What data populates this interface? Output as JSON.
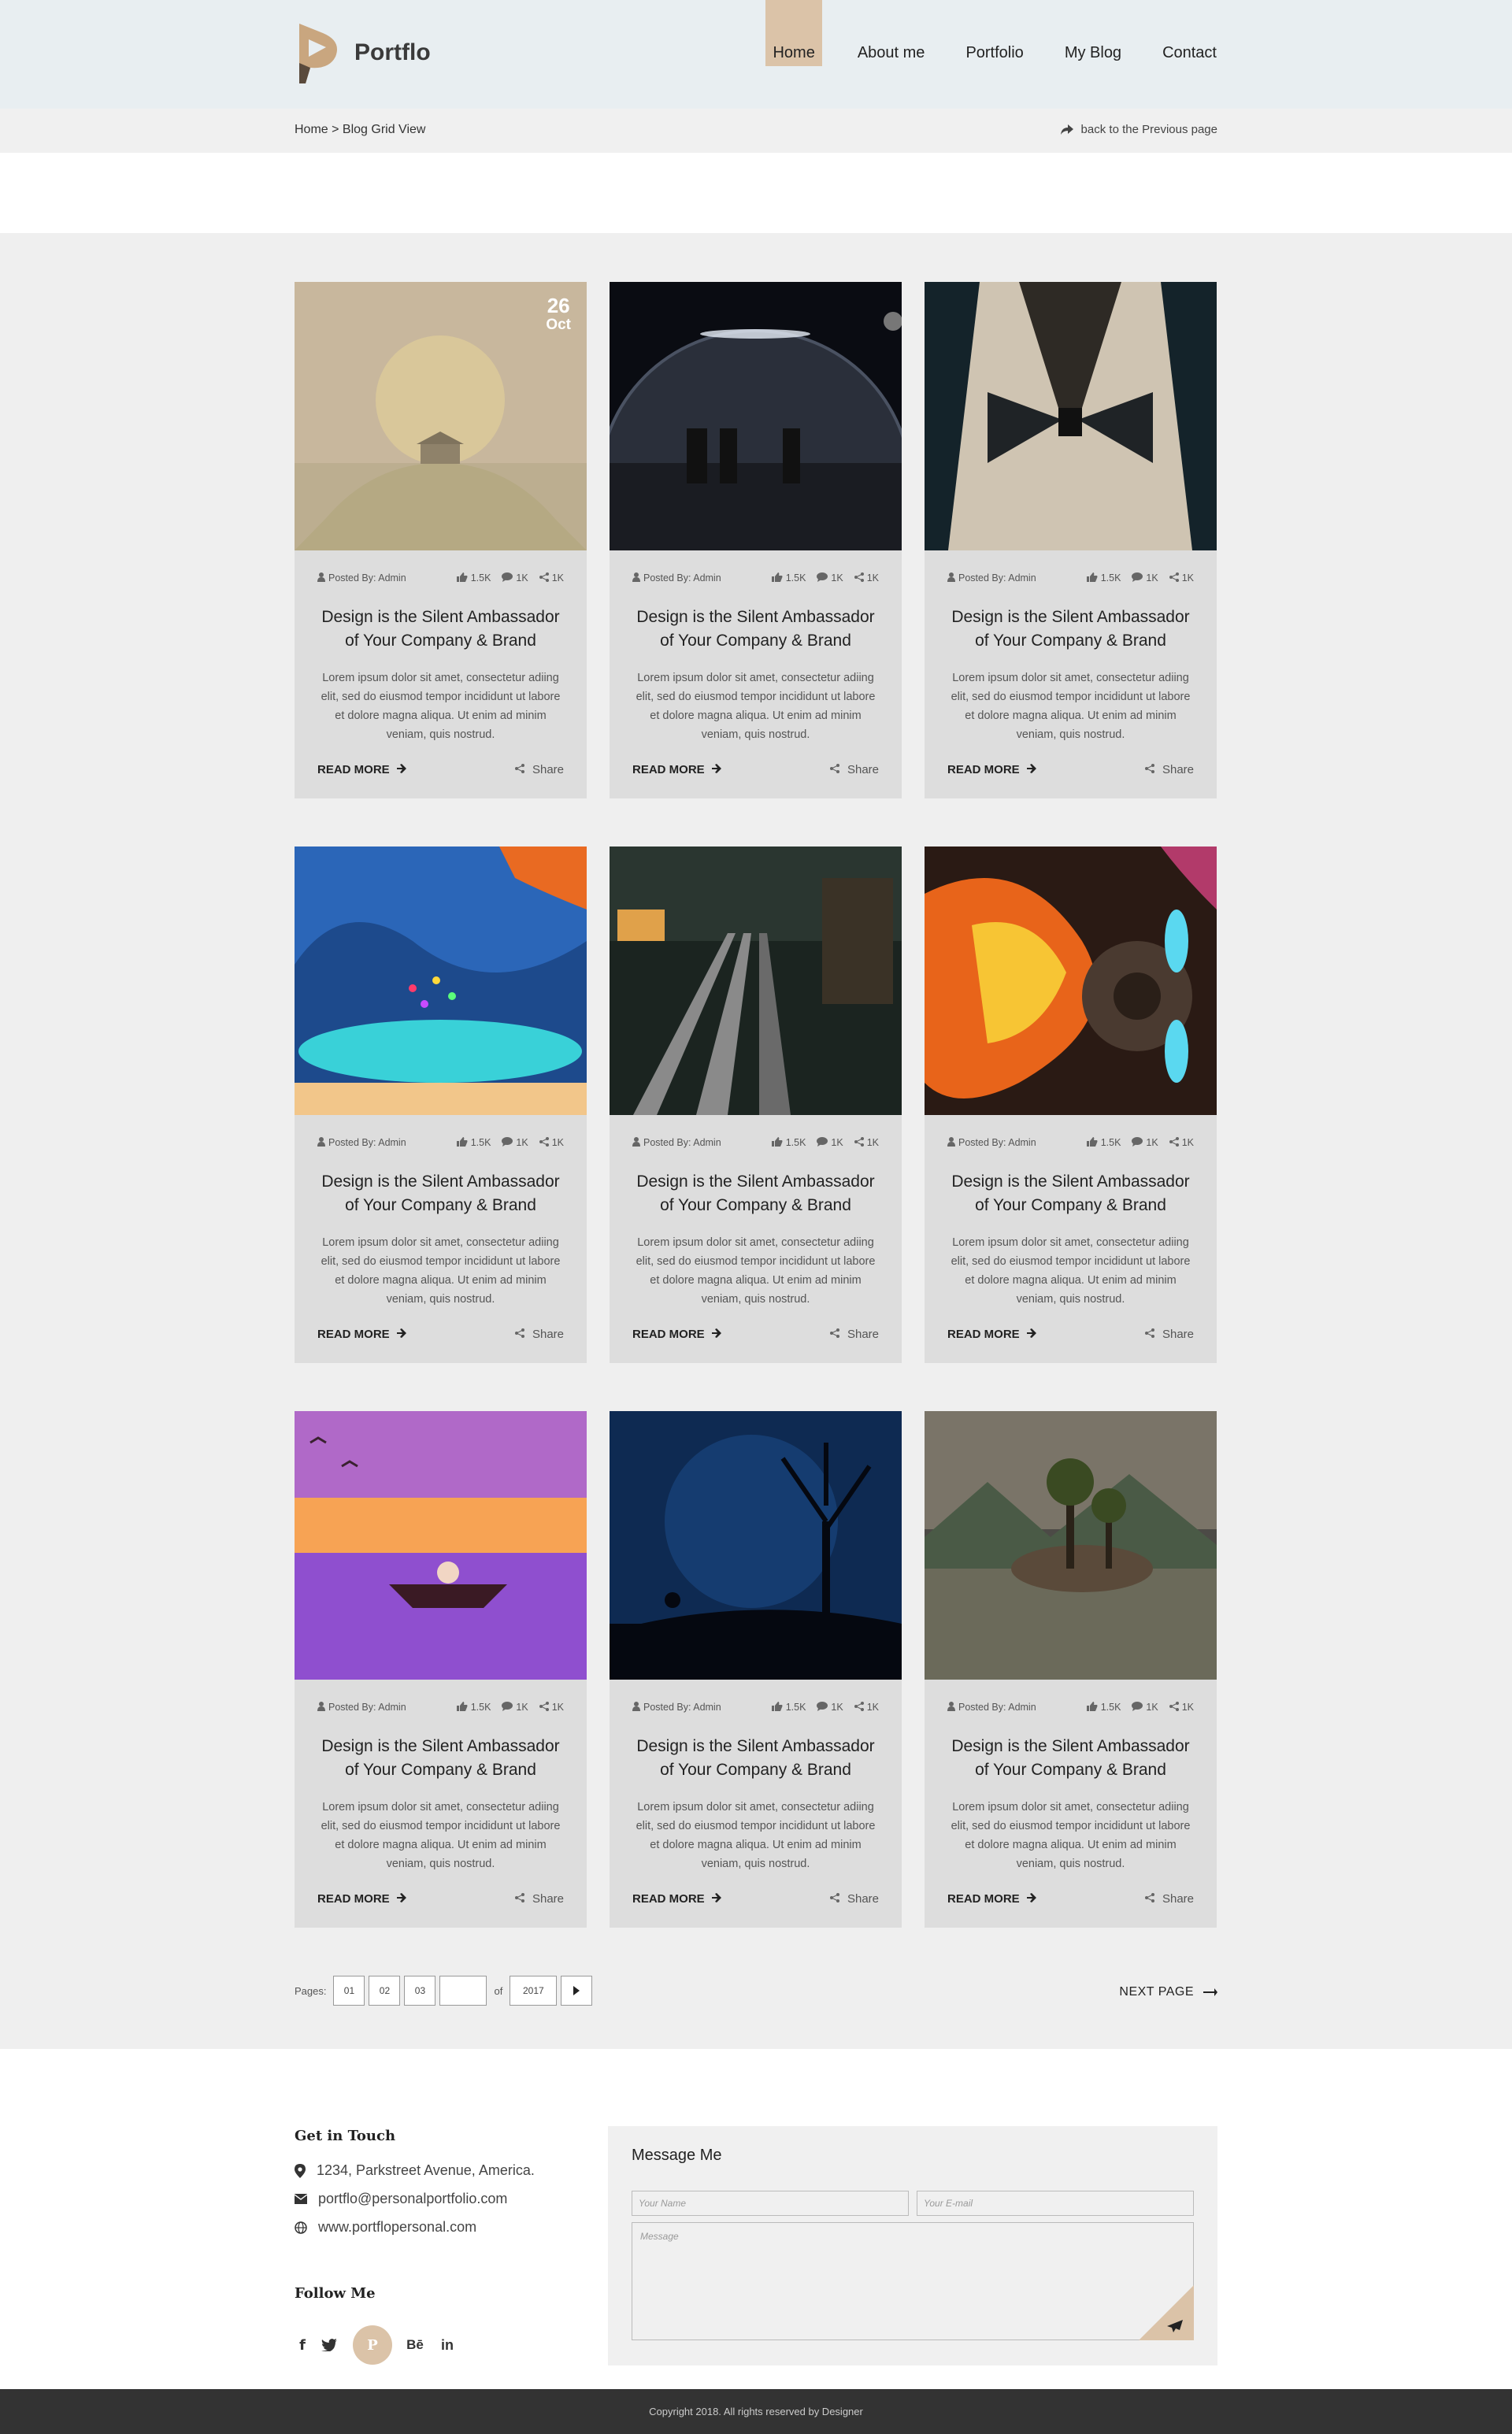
{
  "brand": {
    "name": "Portflo",
    "accent": "#dbc3a8"
  },
  "nav": {
    "items": [
      "Home",
      "About me",
      "Portfolio",
      "My Blog",
      "Contact"
    ],
    "active": "Home"
  },
  "breadcrumb": {
    "text": "Home > Blog Grid View",
    "back_label": "back to the Previous page"
  },
  "featured_date": {
    "day": "26",
    "month": "Oct"
  },
  "post_meta": {
    "posted_by": "Posted By: Admin",
    "likes": "1.5K",
    "comments": "1K",
    "shares": "1K"
  },
  "posts": [
    {
      "title_line1": "Design is the Silent Ambassador",
      "title_line2": "of Your Company & Brand",
      "excerpt": "Lorem ipsum dolor sit amet, consectetur adiing elit, sed do eiusmod tempor incididunt ut labore et dolore magna aliqua. Ut enim ad minim veniam, quis nostrud."
    },
    {
      "title_line1": "Design is the Silent Ambassador",
      "title_line2": "of Your Company & Brand",
      "excerpt": "Lorem ipsum dolor sit amet, consectetur adiing elit, sed do eiusmod tempor incididunt ut labore et dolore magna aliqua. Ut enim ad minim veniam, quis nostrud."
    },
    {
      "title_line1": "Design is the Silent Ambassador",
      "title_line2": "of Your Company & Brand",
      "excerpt": "Lorem ipsum dolor sit amet, consectetur adiing elit, sed do eiusmod tempor incididunt ut labore et dolore magna aliqua. Ut enim ad minim veniam, quis nostrud."
    },
    {
      "title_line1": "Design is the Silent Ambassador",
      "title_line2": "of Your Company & Brand",
      "excerpt": "Lorem ipsum dolor sit amet, consectetur adiing elit, sed do eiusmod tempor incididunt ut labore et dolore magna aliqua. Ut enim ad minim veniam, quis nostrud."
    },
    {
      "title_line1": "Design is the Silent Ambassador",
      "title_line2": "of Your Company & Brand",
      "excerpt": "Lorem ipsum dolor sit amet, consectetur adiing elit, sed do eiusmod tempor incididunt ut labore et dolore magna aliqua. Ut enim ad minim veniam, quis nostrud."
    },
    {
      "title_line1": "Design is the Silent Ambassador",
      "title_line2": "of Your Company & Brand",
      "excerpt": "Lorem ipsum dolor sit amet, consectetur adiing elit, sed do eiusmod tempor incididunt ut labore et dolore magna aliqua. Ut enim ad minim veniam, quis nostrud."
    },
    {
      "title_line1": "Design is the Silent Ambassador",
      "title_line2": "of Your Company & Brand",
      "excerpt": "Lorem ipsum dolor sit amet, consectetur adiing elit, sed do eiusmod tempor incididunt ut labore et dolore magna aliqua. Ut enim ad minim veniam, quis nostrud."
    },
    {
      "title_line1": "Design is the Silent Ambassador",
      "title_line2": "of Your Company & Brand",
      "excerpt": "Lorem ipsum dolor sit amet, consectetur adiing elit, sed do eiusmod tempor incididunt ut labore et dolore magna aliqua. Ut enim ad minim veniam, quis nostrud."
    },
    {
      "title_line1": "Design is the Silent Ambassador",
      "title_line2": "of Your Company & Brand",
      "excerpt": "Lorem ipsum dolor sit amet, consectetur adiing elit, sed do eiusmod tempor incididunt ut labore et dolore magna aliqua. Ut enim ad minim veniam, quis nostrud."
    }
  ],
  "card_actions": {
    "read_more": "READ MORE",
    "share": "Share"
  },
  "pagination": {
    "label": "Pages:",
    "pages": [
      "01",
      "02",
      "03"
    ],
    "current": "",
    "of": "of",
    "total": "2017",
    "next_label": "NEXT PAGE"
  },
  "contact": {
    "title": "Get in Touch",
    "address": "1234, Parkstreet Avenue, America.",
    "email": "portflo@personalportfolio.com",
    "website": "www.portflopersonal.com",
    "follow_title": "Follow Me",
    "socials": [
      "f",
      "twitter",
      "P",
      "Bē",
      "in"
    ]
  },
  "message_form": {
    "title": "Message Me",
    "name_placeholder": "Your Name",
    "email_placeholder": "Your E-mail",
    "message_placeholder": "Message"
  },
  "footer": {
    "copyright": "Copyright 2018. All rights reserved by Designer"
  }
}
